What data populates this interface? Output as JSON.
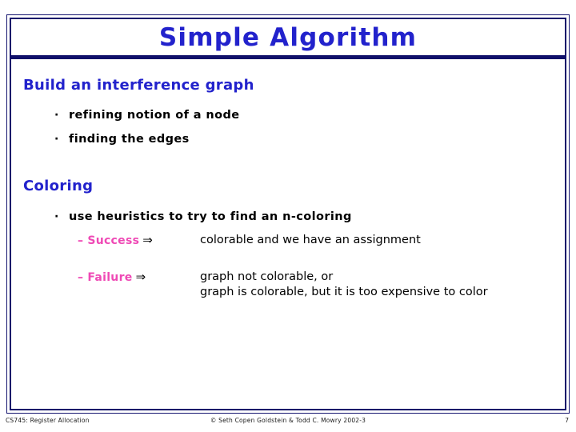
{
  "slide": {
    "title": "Simple Algorithm",
    "accent_color": "#2222cc",
    "frame_color": "#10106a",
    "highlight_color": "#ef49b5",
    "body_color": "#000000",
    "sections": [
      {
        "heading": "Build an interference graph",
        "bullets": [
          {
            "dot": "·",
            "text": "refining notion of a node"
          },
          {
            "dot": "·",
            "text": "finding the edges"
          }
        ]
      },
      {
        "heading": "Coloring",
        "bullets": [
          {
            "dot": "·",
            "text": "use heuristics to try to find an n-coloring"
          }
        ],
        "outcomes": [
          {
            "dash": "–",
            "label": "Success",
            "arrow": "⇒",
            "description_lines": [
              "colorable and we have an assignment"
            ]
          },
          {
            "dash": "–",
            "label": "Failure",
            "arrow": "⇒",
            "description_lines": [
              "graph not colorable, or",
              "graph is colorable, but it is too expensive to color"
            ]
          }
        ]
      }
    ]
  },
  "footer": {
    "left": "CS745: Register Allocation",
    "center": "© Seth Copen Goldstein & Todd C. Mowry 2002-3",
    "page_number": "7"
  }
}
